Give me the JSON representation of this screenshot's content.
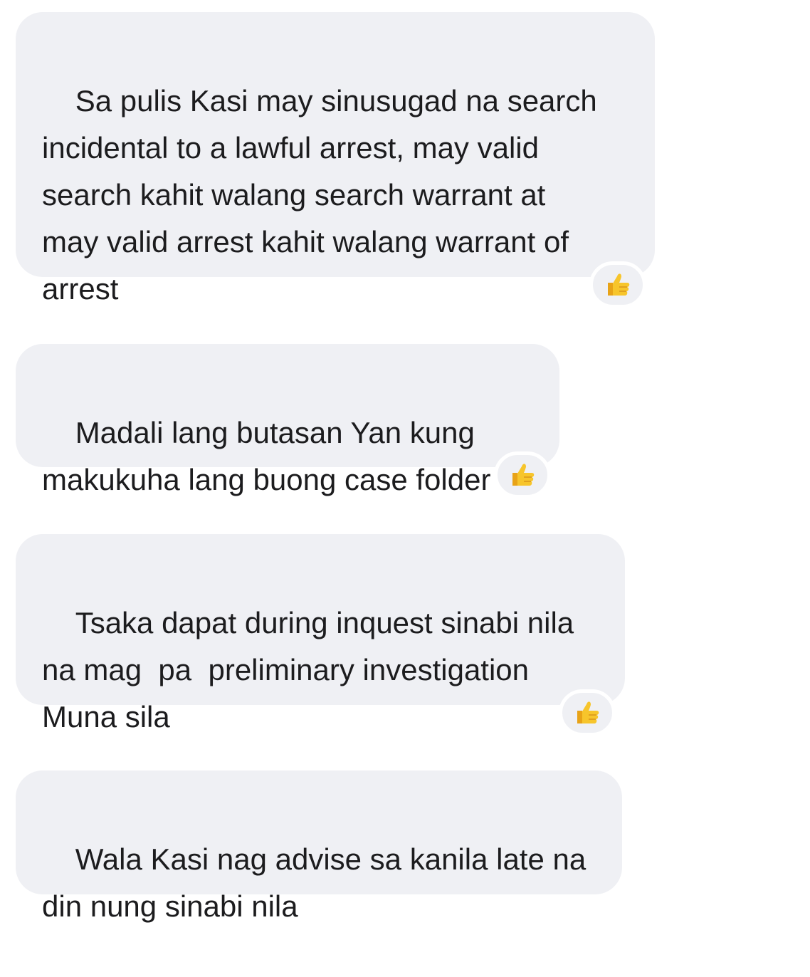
{
  "chat": {
    "messages": [
      {
        "text": "Sa pulis Kasi may sinusugad na search\nincidental to a lawful arrest, may valid\nsearch kahit walang search warrant at\nmay valid arrest kahit walang warrant of\narrest",
        "reaction": "thumbs-up-icon"
      },
      {
        "text": "Madali lang butasan Yan kung\nmakukuha lang buong case folder",
        "reaction": "thumbs-up-icon"
      },
      {
        "text": "Tsaka dapat during inquest sinabi nila\nna mag  pa  preliminary investigation\nMuna sila",
        "reaction": "thumbs-up-icon"
      },
      {
        "text": "Wala Kasi nag advise sa kanila late na\ndin nung sinabi nila",
        "reaction": null
      }
    ]
  },
  "colors": {
    "bubble_bg": "#eff0f4",
    "text": "#1c1c1e",
    "emoji_yellow": "#f7c52b"
  }
}
